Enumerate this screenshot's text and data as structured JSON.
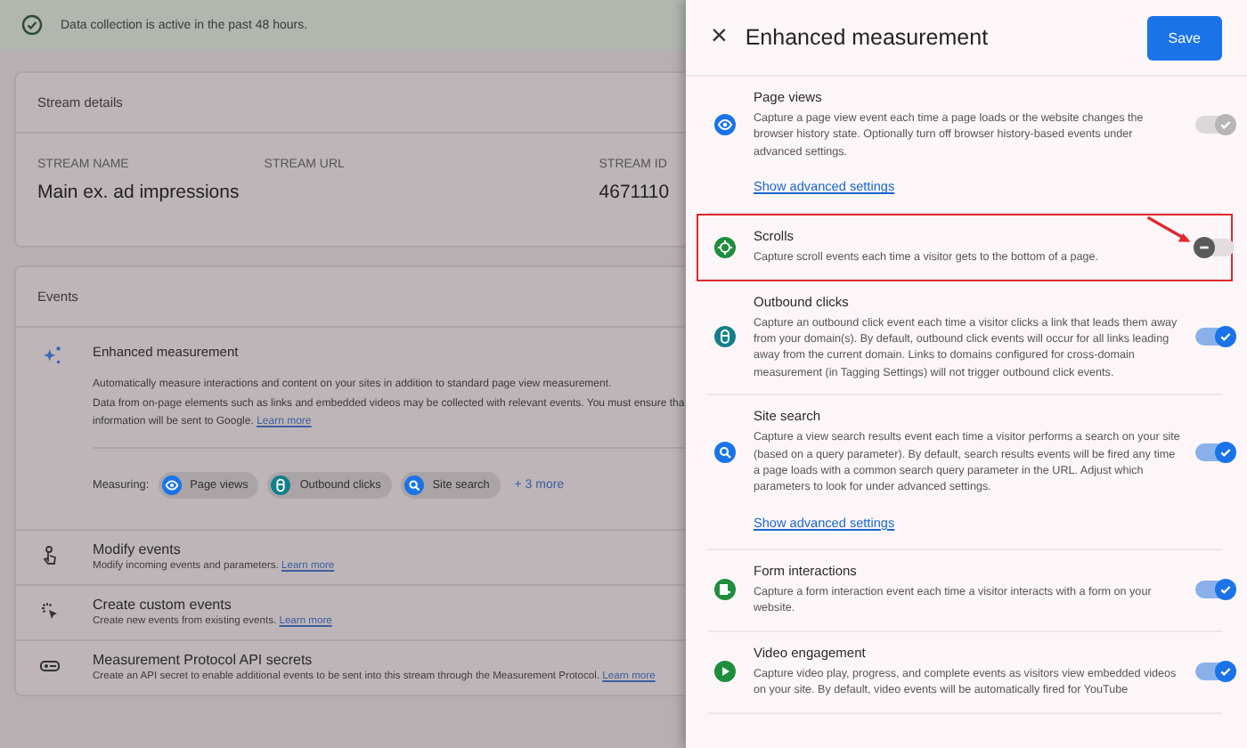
{
  "banner": {
    "text": "Data collection is active in the past 48 hours."
  },
  "stream_details": {
    "title": "Stream details",
    "columns": [
      {
        "label": "STREAM NAME",
        "value": "Main ex. ad impressions"
      },
      {
        "label": "STREAM URL"
      },
      {
        "label": "STREAM ID",
        "value": "4671110"
      }
    ]
  },
  "events": {
    "title": "Events",
    "enhanced": {
      "title": "Enhanced measurement",
      "lines": [
        "Automatically measure interactions and content on your sites in addition to standard page view measurement.",
        "Data from on-page elements such as links and embedded videos may be collected with relevant events. You must ensure tha",
        "information will be sent to Google."
      ],
      "link": "Learn more",
      "measuring_label": "Measuring:",
      "chips": [
        {
          "kind": "page_views",
          "label": "Page views"
        },
        {
          "kind": "outbound",
          "label": "Outbound clicks"
        },
        {
          "kind": "search",
          "label": "Site search"
        }
      ],
      "more": "+ 3 more"
    },
    "items": [
      {
        "kind": "modify",
        "title": "Modify events",
        "description": "Modify incoming events and parameters.",
        "link": "Learn more"
      },
      {
        "kind": "custom",
        "title": "Create custom events",
        "description": "Create new events from existing events.",
        "link": "Learn more"
      },
      {
        "kind": "secrets",
        "title": "Measurement Protocol API secrets",
        "description": "Create an API secret to enable additional events to be sent into this stream through the Measurement Protocol.",
        "link": "Learn more"
      }
    ]
  },
  "panel": {
    "close": "×",
    "title": "Enhanced measurement",
    "save": "Save",
    "items": [
      {
        "kind": "page_views",
        "title": "Page views",
        "description": "Capture a page view event each time a page loads or the website changes the browser history state. Optionally turn off browser history-based events under advanced settings.",
        "on": true,
        "disabled": true,
        "highlighted": false,
        "advanced_link": "Show advanced settings"
      },
      {
        "kind": "scrolls",
        "title": "Scrolls",
        "description": "Capture scroll events each time a visitor gets to the bottom of a page.",
        "on": false,
        "disabled": false,
        "highlighted": true
      },
      {
        "kind": "outbound",
        "title": "Outbound clicks",
        "description": "Capture an outbound click event each time a visitor clicks a link that leads them away from your domain(s). By default, outbound click events will occur for all links leading away from the current domain. Links to domains configured for cross-domain measurement (in Tagging Settings) will not trigger outbound click events.",
        "on": true,
        "disabled": false,
        "highlighted": false
      },
      {
        "kind": "search",
        "title": "Site search",
        "description": "Capture a view search results event each time a visitor performs a search on your site (based on a query parameter). By default, search results events will be fired any time a page loads with a common search query parameter in the URL. Adjust which parameters to look for under advanced settings.",
        "on": true,
        "disabled": false,
        "highlighted": false,
        "advanced_link": "Show advanced settings"
      },
      {
        "kind": "form",
        "title": "Form interactions",
        "description": "Capture a form interaction event each time a visitor interacts with a form on your website.",
        "on": true,
        "disabled": false,
        "highlighted": false
      },
      {
        "kind": "video",
        "title": "Video engagement",
        "description": "Capture video play, progress, and complete events as visitors view embedded videos on your site. By default, video events will be automatically fired for YouTube",
        "on": true,
        "disabled": false,
        "highlighted": false
      }
    ]
  }
}
